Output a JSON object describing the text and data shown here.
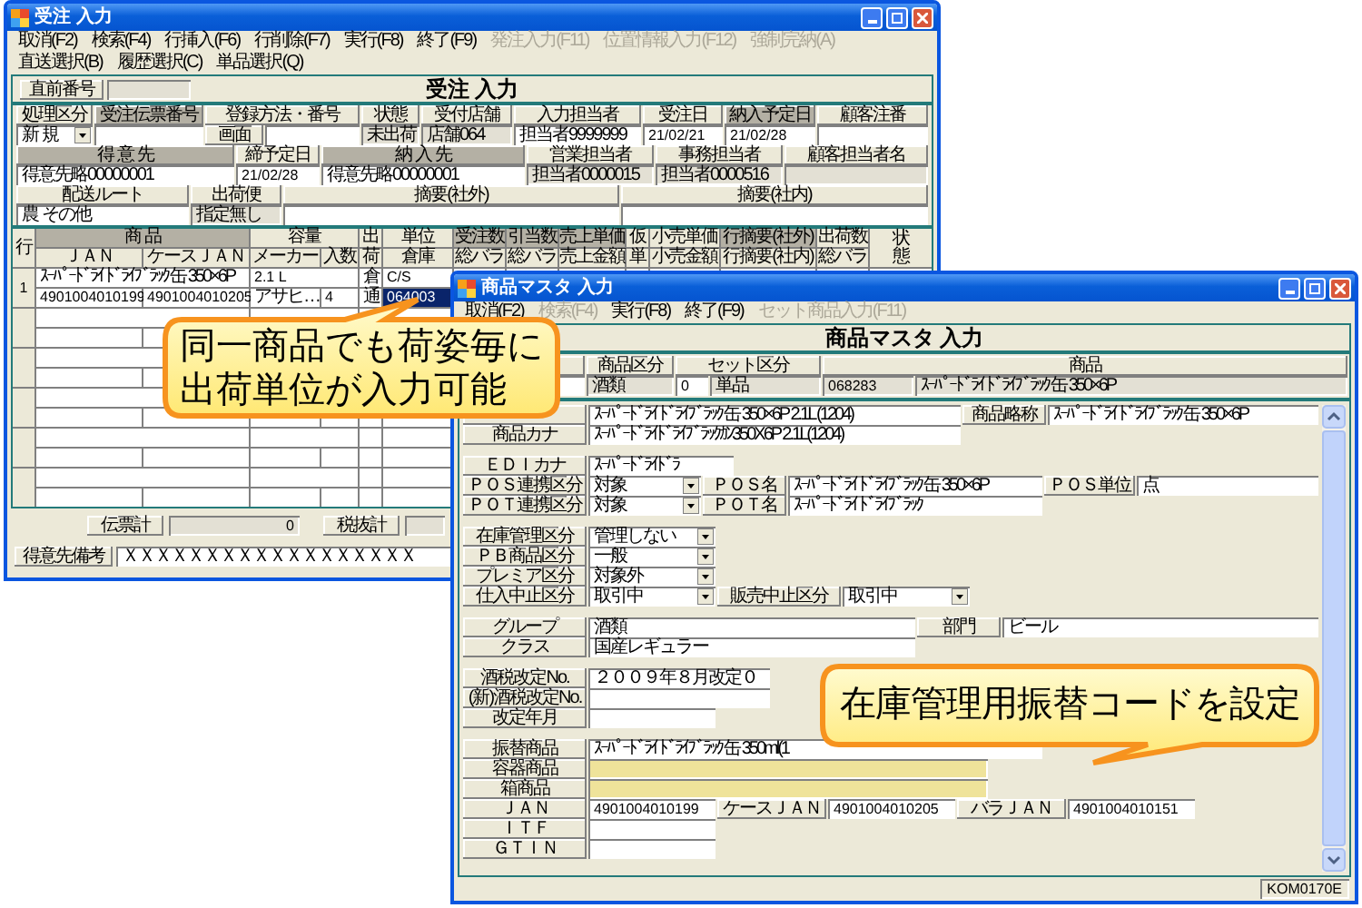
{
  "order_window": {
    "title": "受注 入力",
    "menu": [
      {
        "label": "取消(F2)",
        "disabled": false
      },
      {
        "label": "検索(F4)",
        "disabled": false
      },
      {
        "label": "行挿入(F6)",
        "disabled": false
      },
      {
        "label": "行削除(F7)",
        "disabled": false
      },
      {
        "label": "実行(F8)",
        "disabled": false
      },
      {
        "label": "終了(F9)",
        "disabled": false
      },
      {
        "label": "発注入力(F11)",
        "disabled": true
      },
      {
        "label": "位置情報入力(F12)",
        "disabled": true
      },
      {
        "label": "強制完納(A)",
        "disabled": true
      },
      {
        "label": "直送選択(B)",
        "disabled": false
      },
      {
        "label": "履歴選択(C)",
        "disabled": false
      },
      {
        "label": "単品選択(Q)",
        "disabled": false
      }
    ],
    "header": {
      "label": "直前番号",
      "title": "受注 入力"
    },
    "form_rows": [
      [
        {
          "kind": "label",
          "text": "処理区分"
        },
        {
          "kind": "label-dark",
          "text": "受注伝票番号"
        },
        {
          "kind": "label",
          "text": "登録方法・番号"
        },
        {
          "kind": "label",
          "text": "状態"
        },
        {
          "kind": "label",
          "text": "受付店舗"
        },
        {
          "kind": "label",
          "text": "入力担当者"
        },
        {
          "kind": "label",
          "text": "受注日"
        },
        {
          "kind": "label-dark",
          "text": "納入予定日"
        },
        {
          "kind": "label",
          "text": "顧客注番"
        }
      ],
      [
        {
          "kind": "select",
          "text": "新 規"
        },
        {
          "kind": "field"
        },
        {
          "kind": "label",
          "text": "画面"
        },
        {
          "kind": "field"
        },
        {
          "kind": "display",
          "text": "未出荷"
        },
        {
          "kind": "display",
          "text": "店舗064"
        },
        {
          "kind": "field",
          "text": "担当者9999999"
        },
        {
          "kind": "field",
          "text": "21/02/21"
        },
        {
          "kind": "field",
          "text": "21/02/28"
        },
        {
          "kind": "field"
        }
      ],
      [
        {
          "kind": "label-dark",
          "text": "得 意 先"
        },
        {
          "kind": "label",
          "text": "締予定日"
        },
        {
          "kind": "label-dark",
          "text": "納 入 先"
        },
        {
          "kind": "label",
          "text": "営業担当者"
        },
        {
          "kind": "label",
          "text": "事務担当者"
        },
        {
          "kind": "label",
          "text": "顧客担当者名"
        }
      ],
      [
        {
          "kind": "field",
          "text": "得意先略00000001"
        },
        {
          "kind": "field",
          "text": "21/02/28"
        },
        {
          "kind": "field",
          "text": "得意先略00000001"
        },
        {
          "kind": "display",
          "text": "担当者0000015"
        },
        {
          "kind": "display",
          "text": "担当者0000516"
        },
        {
          "kind": "display"
        }
      ],
      [
        {
          "kind": "label",
          "text": "配送ルート"
        },
        {
          "kind": "label",
          "text": "出荷便"
        },
        {
          "kind": "label",
          "text": "摘要(社外)"
        },
        {
          "kind": "label",
          "text": "摘要(社内)"
        }
      ],
      [
        {
          "kind": "field",
          "text": "農 その他"
        },
        {
          "kind": "display",
          "text": "指定無し"
        },
        {
          "kind": "field"
        },
        {
          "kind": "field"
        }
      ]
    ],
    "detail_header_top": [
      {
        "text": "行",
        "dark": false
      },
      {
        "text": "商 品",
        "dark": true
      },
      {
        "text": "容量",
        "dark": false
      },
      {
        "text": "出",
        "dark": false
      },
      {
        "text": "単位",
        "dark": false
      },
      {
        "text": "受注数",
        "dark": true
      },
      {
        "text": "引当数",
        "dark": true
      },
      {
        "text": "売上単価",
        "dark": true
      },
      {
        "text": "仮",
        "dark": false
      },
      {
        "text": "小売単価",
        "dark": false
      },
      {
        "text": "行摘要(社外)",
        "dark": true
      },
      {
        "text": "出荷数",
        "dark": false
      },
      {
        "text": "状態",
        "dark": false
      }
    ],
    "detail_header_bottom": [
      {
        "text": "ＪＡＮ",
        "dark": false
      },
      {
        "text": "ケースＪＡＮ",
        "dark": false
      },
      {
        "text": "メーカー",
        "dark": false
      },
      {
        "text": "入数",
        "dark": false
      },
      {
        "text": "荷",
        "dark": false
      },
      {
        "text": "倉庫",
        "dark": false
      },
      {
        "text": "総バラ",
        "dark": false
      },
      {
        "text": "総バラ",
        "dark": false
      },
      {
        "text": "売上金額",
        "dark": false
      },
      {
        "text": "単",
        "dark": false
      },
      {
        "text": "小売金額",
        "dark": false
      },
      {
        "text": "行摘要(社内)",
        "dark": false
      },
      {
        "text": "総バラ",
        "dark": false
      }
    ],
    "detail_rows": [
      {
        "number": "1",
        "line1": [
          {
            "text": "ｽｰﾊﾟｰﾄﾞﾗｲ ﾄﾞﾗｲﾌﾞﾗｯｸ 缶 350×6P",
            "selected": false
          },
          {
            "text": "2.1 L",
            "selected": false
          },
          {
            "text": "倉",
            "selected": false
          },
          {
            "text": "C/S",
            "selected": false
          }
        ],
        "line2": [
          {
            "text": "4901004010199",
            "selected": false
          },
          {
            "text": "4901004010205",
            "selected": false
          },
          {
            "text": "アサヒ…",
            "selected": false
          },
          {
            "text": "4",
            "selected": false
          },
          {
            "text": "通",
            "selected": false
          },
          {
            "text": "064003",
            "selected": true
          }
        ]
      }
    ],
    "totals": [
      {
        "label": "伝票計",
        "value": "0"
      },
      {
        "label": "税抜計"
      }
    ],
    "customer_note": {
      "label": "得意先備考",
      "value": "ＸＸＸＸＸＸＸＸＸＸＸＸＸＸＸＸＸＸ"
    }
  },
  "product_window": {
    "title": "商品マスタ 入力",
    "menu": [
      {
        "label": "取消(F2)",
        "disabled": false
      },
      {
        "label": "検索(F4)",
        "disabled": true
      },
      {
        "label": "実行(F8)",
        "disabled": false
      },
      {
        "label": "終了(F9)",
        "disabled": false
      },
      {
        "label": "セット商品入力(F11)",
        "disabled": true
      }
    ],
    "header": {
      "title": "商品マスタ 入力"
    },
    "summary_rows": [
      [
        {
          "kind": "label"
        },
        {
          "kind": "label",
          "text": "商品区分"
        },
        {
          "kind": "label",
          "text": "セット区分"
        },
        {
          "kind": "label",
          "text": "商品"
        }
      ],
      [
        {
          "kind": "field"
        },
        {
          "kind": "display",
          "text": "酒類"
        },
        {
          "kind": "field",
          "text": "0"
        },
        {
          "kind": "display",
          "text": "単品"
        },
        {
          "kind": "display",
          "text": "068283"
        },
        {
          "kind": "display",
          "text": "ｽｰﾊﾟｰﾄﾞﾗｲ ﾄﾞﾗｲﾌﾞﾗｯｸ 缶 350×6P"
        }
      ]
    ],
    "sections": [
      [
        [
          {
            "kind": "label"
          },
          {
            "kind": "field",
            "text": "ｽｰﾊﾟｰﾄﾞﾗｲ ﾄﾞﾗｲﾌﾞﾗｯｸ 缶 350×6P 2.1L (1204)"
          },
          {
            "kind": "label",
            "text": "商品略称"
          },
          {
            "kind": "field",
            "text": "ｽｰﾊﾟｰﾄﾞﾗｲ ﾄﾞﾗｲﾌﾞﾗｯｸ 缶 350×6P"
          }
        ],
        [
          {
            "kind": "label",
            "text": "商品カナ"
          },
          {
            "kind": "field",
            "text": "ｽｰﾊﾟｰﾄﾞﾗｲﾄﾞﾗｲﾌﾞﾗｯｸｶﾝ350X6P 2.1L(1204)"
          }
        ]
      ],
      [
        [
          {
            "kind": "label",
            "text": "ＥＤＩカナ"
          },
          {
            "kind": "field",
            "text": "ｽｰﾊﾟｰﾄﾞﾗｲﾄﾞﾗ"
          }
        ],
        [
          {
            "kind": "label",
            "text": "ＰＯＳ連携区分"
          },
          {
            "kind": "select",
            "text": "対象"
          },
          {
            "kind": "label",
            "text": "ＰＯＳ名"
          },
          {
            "kind": "field",
            "text": "ｽｰﾊﾟｰﾄﾞﾗｲ ﾄﾞﾗｲﾌﾞﾗｯｸ 缶 350×6P"
          },
          {
            "kind": "label",
            "text": "ＰＯＳ単位"
          },
          {
            "kind": "field",
            "text": "点"
          }
        ],
        [
          {
            "kind": "label",
            "text": "ＰＯＴ連携区分"
          },
          {
            "kind": "select",
            "text": "対象"
          },
          {
            "kind": "label",
            "text": "ＰＯＴ名"
          },
          {
            "kind": "field",
            "text": "ｽｰﾊﾟｰﾄﾞﾗｲ ﾄﾞﾗｲﾌﾞﾗｯｸ"
          }
        ]
      ],
      [
        [
          {
            "kind": "label",
            "text": "在庫管理区分"
          },
          {
            "kind": "select",
            "text": "管理しない"
          }
        ],
        [
          {
            "kind": "label",
            "text": "ＰＢ商品区分"
          },
          {
            "kind": "select",
            "text": "一般"
          }
        ],
        [
          {
            "kind": "label",
            "text": "プレミア区分"
          },
          {
            "kind": "select",
            "text": "対象外"
          }
        ],
        [
          {
            "kind": "label",
            "text": "仕入中止区分"
          },
          {
            "kind": "select",
            "text": "取引中"
          },
          {
            "kind": "label",
            "text": "販売中止区分"
          },
          {
            "kind": "select",
            "text": "取引中"
          }
        ]
      ],
      [
        [
          {
            "kind": "label",
            "text": "グループ"
          },
          {
            "kind": "field",
            "text": "酒類"
          },
          {
            "kind": "label",
            "text": "部門"
          },
          {
            "kind": "field",
            "text": "ビール"
          }
        ],
        [
          {
            "kind": "label",
            "text": "クラス"
          },
          {
            "kind": "field",
            "text": "国産レギュラー"
          }
        ]
      ],
      [
        [
          {
            "kind": "label",
            "text": "酒税改定No."
          },
          {
            "kind": "field",
            "text": "２００９年８月改定０"
          }
        ],
        [
          {
            "kind": "label",
            "text": "(新)酒税改定No."
          },
          {
            "kind": "field"
          }
        ],
        [
          {
            "kind": "label",
            "text": "改定年月"
          },
          {
            "kind": "field"
          }
        ]
      ],
      [
        [
          {
            "kind": "label",
            "text": "振替商品"
          },
          {
            "kind": "field",
            "text": "ｽｰﾊﾟｰﾄﾞﾗｲ ﾄﾞﾗｲﾌﾞﾗｯｸ 缶 350ml(1"
          }
        ],
        [
          {
            "kind": "label",
            "text": "容器商品"
          },
          {
            "kind": "shaded-field"
          }
        ],
        [
          {
            "kind": "label",
            "text": "箱商品"
          },
          {
            "kind": "shaded-field"
          }
        ],
        [
          {
            "kind": "label",
            "text": "ＪＡＮ"
          },
          {
            "kind": "field",
            "text": "4901004010199"
          },
          {
            "kind": "label",
            "text": "ケースＪＡＮ"
          },
          {
            "kind": "field",
            "text": "4901004010205"
          },
          {
            "kind": "label",
            "text": "バラＪＡＮ"
          },
          {
            "kind": "field",
            "text": "4901004010151"
          }
        ],
        [
          {
            "kind": "label",
            "text": "ＩＴＦ"
          },
          {
            "kind": "field"
          }
        ],
        [
          {
            "kind": "label",
            "text": "ＧＴＩＮ"
          },
          {
            "kind": "field"
          }
        ]
      ]
    ],
    "status_code": "KOM0170E"
  },
  "callouts": [
    {
      "text": "同一商品でも荷姿毎に出荷単位が入力可能"
    },
    {
      "text": "在庫管理用振替コードを設定"
    }
  ]
}
